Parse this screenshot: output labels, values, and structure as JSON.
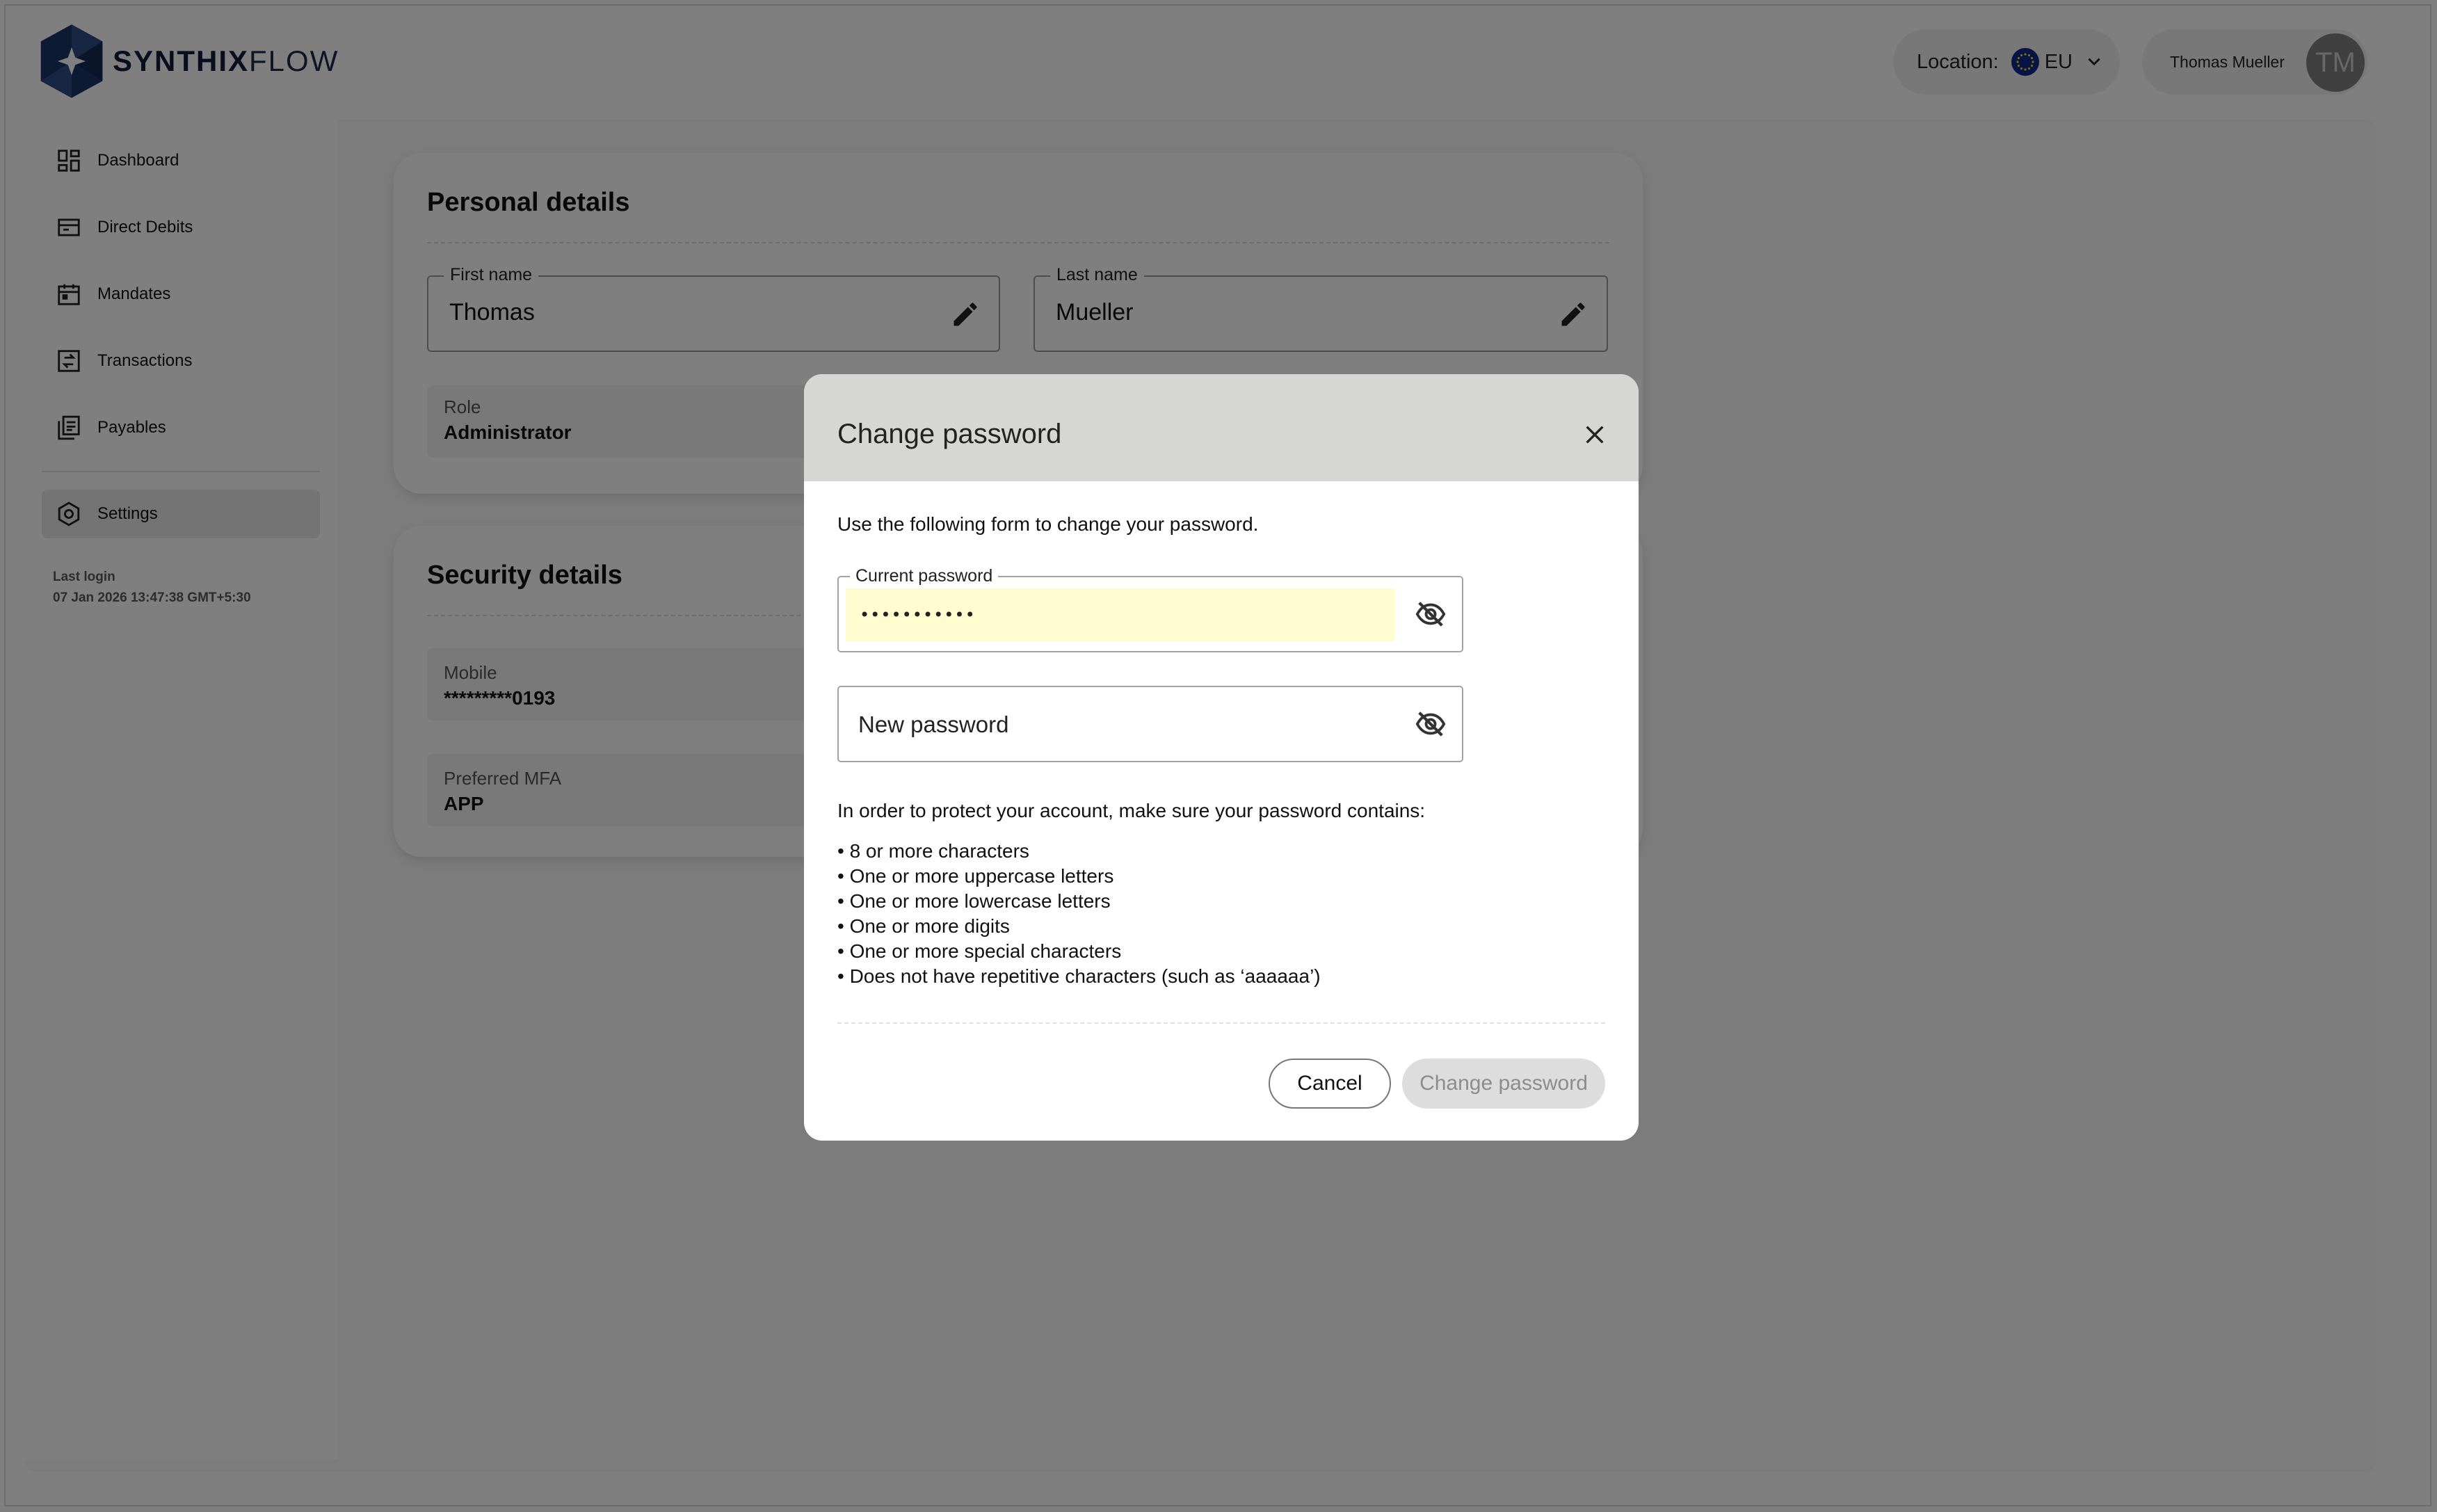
{
  "brand": {
    "name_bold": "SYNTHIX",
    "name_light": "FLOW"
  },
  "header": {
    "location_label": "Location:",
    "location_value": "EU",
    "user_name": "Thomas Mueller",
    "avatar_initials": "TM"
  },
  "sidebar": {
    "items": [
      {
        "label": "Dashboard",
        "icon": "dashboard-icon"
      },
      {
        "label": "Direct Debits",
        "icon": "direct-debits-icon"
      },
      {
        "label": "Mandates",
        "icon": "calendar-icon"
      },
      {
        "label": "Transactions",
        "icon": "transactions-icon"
      },
      {
        "label": "Payables",
        "icon": "payables-icon"
      }
    ],
    "settings": {
      "label": "Settings",
      "icon": "gear-icon",
      "active": true
    },
    "last_login_label": "Last login",
    "last_login_value": "07 Jan 2026 13:47:38 GMT+5:30"
  },
  "personal": {
    "title": "Personal details",
    "first_name_label": "First name",
    "first_name_value": "Thomas",
    "last_name_label": "Last name",
    "last_name_value": "Mueller",
    "role_label": "Role",
    "role_value": "Administrator"
  },
  "security": {
    "title": "Security details",
    "mobile_label": "Mobile",
    "mobile_value": "*********0193",
    "mfa_label": "Preferred MFA",
    "mfa_value": "APP"
  },
  "modal": {
    "title": "Change password",
    "intro": "Use the following form to change your password.",
    "current_password_label": "Current password",
    "current_password_value": "•••••••••••",
    "new_password_placeholder": "New password",
    "requirements_intro": "In order to protect your account, make sure your password contains:",
    "requirements": [
      "• 8 or more characters",
      "• One or more uppercase letters",
      "• One or more lowercase letters",
      "• One or more digits",
      "• One or more special characters",
      "• Does not have repetitive characters (such as ‘aaaaaa’)"
    ],
    "cancel_label": "Cancel",
    "submit_label": "Change password"
  },
  "colors": {
    "brand_navy": "#101c3c",
    "autofill_yellow": "#fffcd0",
    "modal_header": "#d6d6d4",
    "overlay": "rgba(0,0,0,0.5)"
  }
}
